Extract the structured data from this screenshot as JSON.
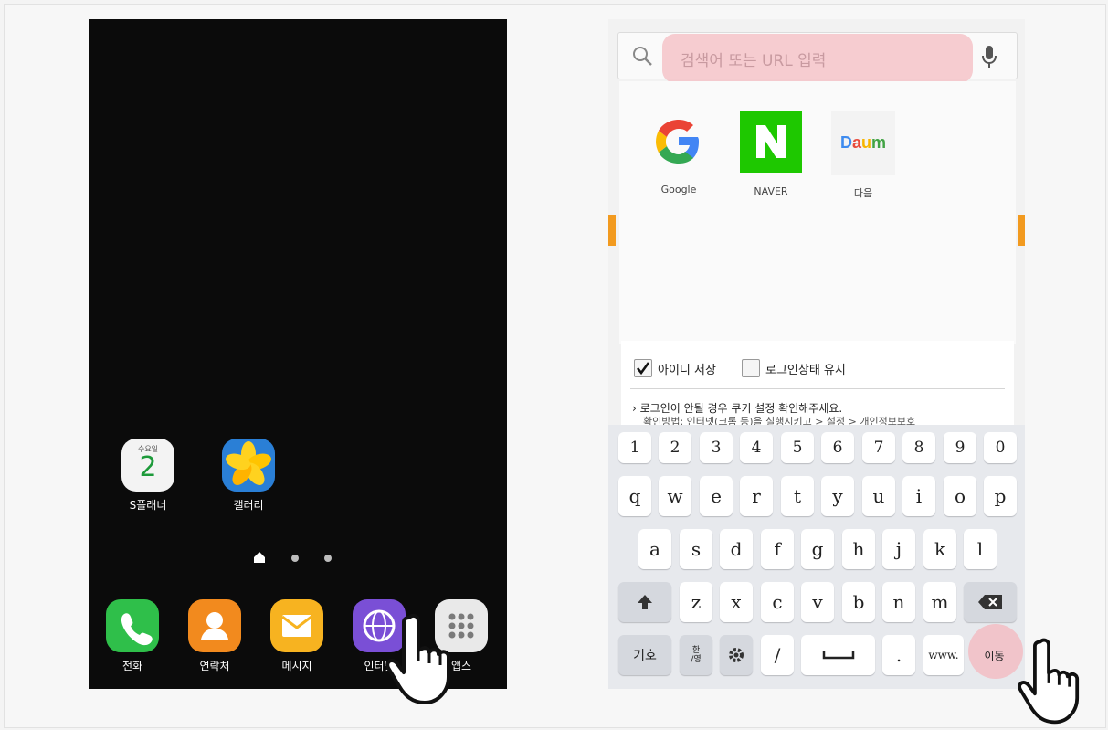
{
  "home": {
    "apps": [
      {
        "label": "S플래너",
        "day": "수요일",
        "date": "2"
      },
      {
        "label": "갤러리"
      }
    ],
    "dock": [
      {
        "label": "전화"
      },
      {
        "label": "연락처"
      },
      {
        "label": "메시지"
      },
      {
        "label": "인터넷"
      },
      {
        "label": "앱스"
      }
    ]
  },
  "browser": {
    "search_placeholder": "검색어 또는 URL 입력",
    "quick_links": [
      {
        "label": "Google"
      },
      {
        "label": "NAVER"
      },
      {
        "label": "다음",
        "logo": "Daum"
      }
    ],
    "login": {
      "save_id": "아이디 저장",
      "keep_login": "로그인상태 유지",
      "notice": "로그인이 안될 경우 쿠키 설정 확인해주세요.",
      "notice2": "확인방법: 인터넷(크롬 등)을 실행시키고 > 설정 > 개인정보보호"
    }
  },
  "keyboard": {
    "row1": [
      "1",
      "2",
      "3",
      "4",
      "5",
      "6",
      "7",
      "8",
      "9",
      "0"
    ],
    "row2": [
      "q",
      "w",
      "e",
      "r",
      "t",
      "y",
      "u",
      "i",
      "o",
      "p"
    ],
    "row3": [
      "a",
      "s",
      "d",
      "f",
      "g",
      "h",
      "j",
      "k",
      "l"
    ],
    "row4": [
      "z",
      "x",
      "c",
      "v",
      "b",
      "n",
      "m"
    ],
    "symbols": "기호",
    "lang_top": "한",
    "lang_bottom": "영",
    "slash": "/",
    "period": ".",
    "www": "www.",
    "go": "이동"
  },
  "colors": {
    "naver": "#1ec800",
    "highlight": "#f4c3c8",
    "orange": "#f29a1f"
  }
}
